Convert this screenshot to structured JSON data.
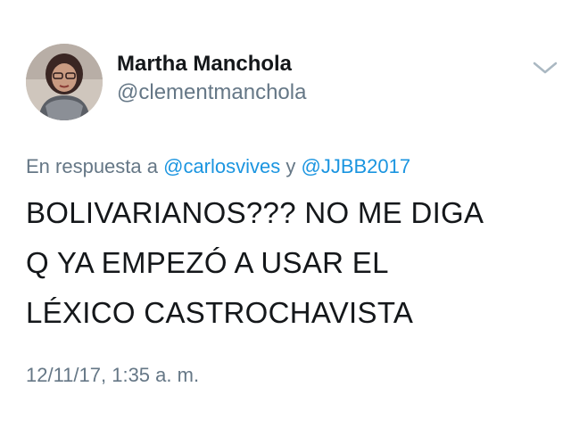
{
  "author": {
    "display_name": "Martha Manchola",
    "handle": "@clementmanchola",
    "avatar_icon": "profile-photo"
  },
  "menu": {
    "icon": "chevron-down-icon"
  },
  "reply": {
    "prefix": "En respuesta a",
    "mention_1": "@carlosvives",
    "connector": "y",
    "mention_2": "@JJBB2017"
  },
  "tweet": {
    "lines": [
      "BOLIVARIANOS??? NO ME DIGA",
      "Q YA EMPEZÓ A USAR EL",
      "LÉXICO CASTROCHAVISTA"
    ]
  },
  "timestamp": "12/11/17, 1:35 a. m.",
  "colors": {
    "text": "#14171a",
    "secondary": "#657786",
    "link": "#1b95e0"
  }
}
